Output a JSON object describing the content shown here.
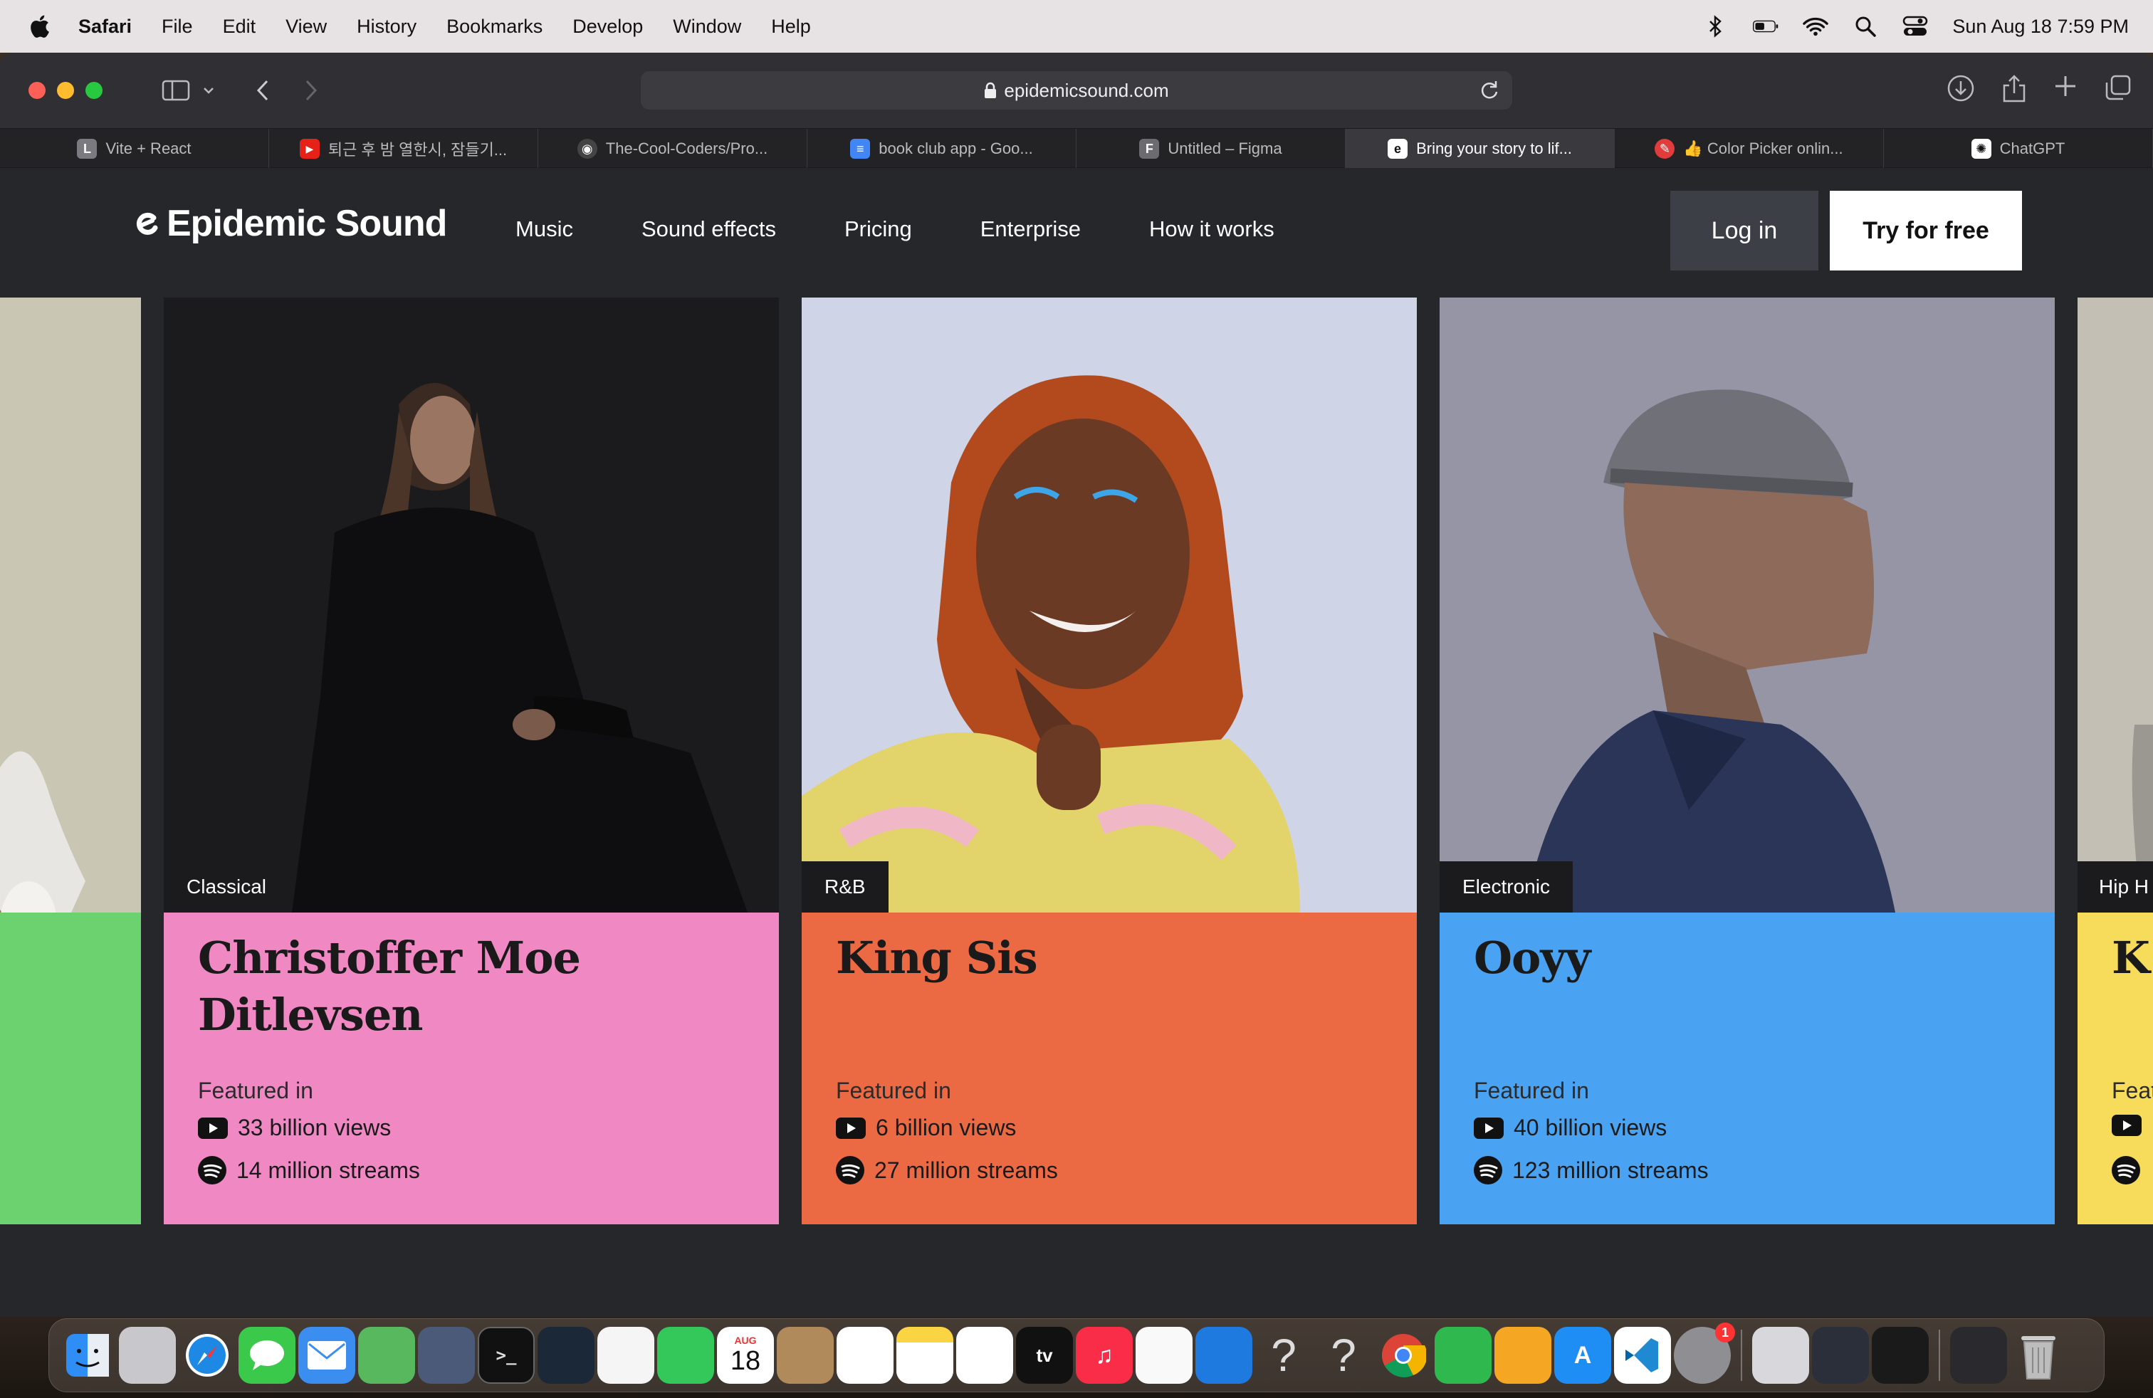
{
  "menubar": {
    "app": "Safari",
    "items": [
      "File",
      "Edit",
      "View",
      "History",
      "Bookmarks",
      "Develop",
      "Window",
      "Help"
    ],
    "clock": "Sun Aug 18  7:59 PM"
  },
  "browser": {
    "url": "epidemicsound.com",
    "tabs": [
      {
        "label": "Vite + React",
        "favicon": "L",
        "color": "#7a7a80"
      },
      {
        "label": "퇴근 후 밤 열한시, 잠들기...",
        "favicon": "▶",
        "color": "#e62117"
      },
      {
        "label": "The-Cool-Coders/Pro...",
        "favicon": "◉",
        "color": "#444"
      },
      {
        "label": "book club app - Goo...",
        "favicon": "≡",
        "color": "#4285f4"
      },
      {
        "label": "Untitled – Figma",
        "favicon": "F",
        "color": "#6b6b70"
      },
      {
        "label": "Bring your story to lif...",
        "favicon": "e",
        "color": "#ffffff"
      },
      {
        "label": "👍 Color Picker onlin...",
        "favicon": "✎",
        "color": "#e23b3b"
      },
      {
        "label": "ChatGPT",
        "favicon": "✺",
        "color": "#ffffff"
      }
    ]
  },
  "site": {
    "logo": "Epidemic Sound",
    "nav": [
      "Music",
      "Sound effects",
      "Pricing",
      "Enterprise",
      "How it works"
    ],
    "login": "Log in",
    "try": "Try for free"
  },
  "cards": [
    {
      "genre": "Classical",
      "artist": "Christoffer Moe Ditlevsen",
      "featured": "Featured in",
      "views": "33 billion views",
      "streams": "14 million streams",
      "panel_color": "#ef88c3",
      "photo_color": "#1b1b1e"
    },
    {
      "genre": "R&B",
      "artist": "King Sis",
      "featured": "Featured in",
      "views": "6 billion views",
      "streams": "27 million streams",
      "panel_color": "#ec6a43",
      "photo_color": "#cfd5e6"
    },
    {
      "genre": "Electronic",
      "artist": "Ooyy",
      "featured": "Featured in",
      "views": "40 billion views",
      "streams": "123 million streams",
      "panel_color": "#4aa3f2",
      "photo_color": "#9595a6"
    }
  ],
  "partial_right": {
    "genre": "Hip H",
    "artist": "K",
    "featured": "Feat",
    "panel_color": "#f7dc5c"
  },
  "partial_left": {
    "panel_color": "#6cd26f",
    "photo_color": "#c9c6b4"
  },
  "dock": {
    "calendar_month": "AUG",
    "calendar_day": "18",
    "badge_count": "1",
    "icons": [
      {
        "name": "finder-icon",
        "color": "#2f8ef5"
      },
      {
        "name": "launchpad-icon",
        "color": "#c7c7cc"
      },
      {
        "name": "safari-icon",
        "color": "#1e88e5"
      },
      {
        "name": "messages-icon",
        "color": "#3ac94b"
      },
      {
        "name": "mail-icon",
        "color": "#3b8ef0"
      },
      {
        "name": "maps-icon",
        "color": "#58b85e"
      },
      {
        "name": "robot-app-icon",
        "color": "#4a5a78"
      },
      {
        "name": "terminal-icon",
        "color": "#111111"
      },
      {
        "name": "steam-icon",
        "color": "#1b2838"
      },
      {
        "name": "photos-icon",
        "color": "#f5f5f5"
      },
      {
        "name": "facetime-icon",
        "color": "#34c759"
      },
      {
        "name": "calendar-icon",
        "color": "#ffffff"
      },
      {
        "name": "contacts-icon",
        "color": "#b08a5a"
      },
      {
        "name": "reminders-icon",
        "color": "#ffffff"
      },
      {
        "name": "notes-icon",
        "color": "#fbd444"
      },
      {
        "name": "freeform-icon",
        "color": "#ffffff"
      },
      {
        "name": "tv-icon",
        "color": "#111111"
      },
      {
        "name": "music-icon",
        "color": "#fa2d48"
      },
      {
        "name": "news-icon",
        "color": "#f9f9f9"
      },
      {
        "name": "keynote-icon",
        "color": "#1f7ae0"
      },
      {
        "name": "unknown-app-icon",
        "color": "transparent"
      },
      {
        "name": "unknown-app-icon-2",
        "color": "transparent"
      },
      {
        "name": "chrome-icon",
        "color": "#ffffff"
      },
      {
        "name": "numbers-icon",
        "color": "#2fb84e"
      },
      {
        "name": "pages-icon",
        "color": "#f5a623"
      },
      {
        "name": "app-store-icon",
        "color": "#1e8ef5"
      },
      {
        "name": "vscode-icon",
        "color": "#ffffff"
      },
      {
        "name": "system-settings-icon",
        "color": "#8e8e93"
      },
      {
        "name": "preview-icon",
        "color": "#d8d8dc"
      },
      {
        "name": "davinci-icon",
        "color": "#2a2f3a"
      },
      {
        "name": "voice-memos-icon",
        "color": "#1a1a1a"
      },
      {
        "name": "screen-app-icon",
        "color": "#2a2a2e"
      },
      {
        "name": "trash-icon",
        "color": "transparent"
      }
    ]
  }
}
